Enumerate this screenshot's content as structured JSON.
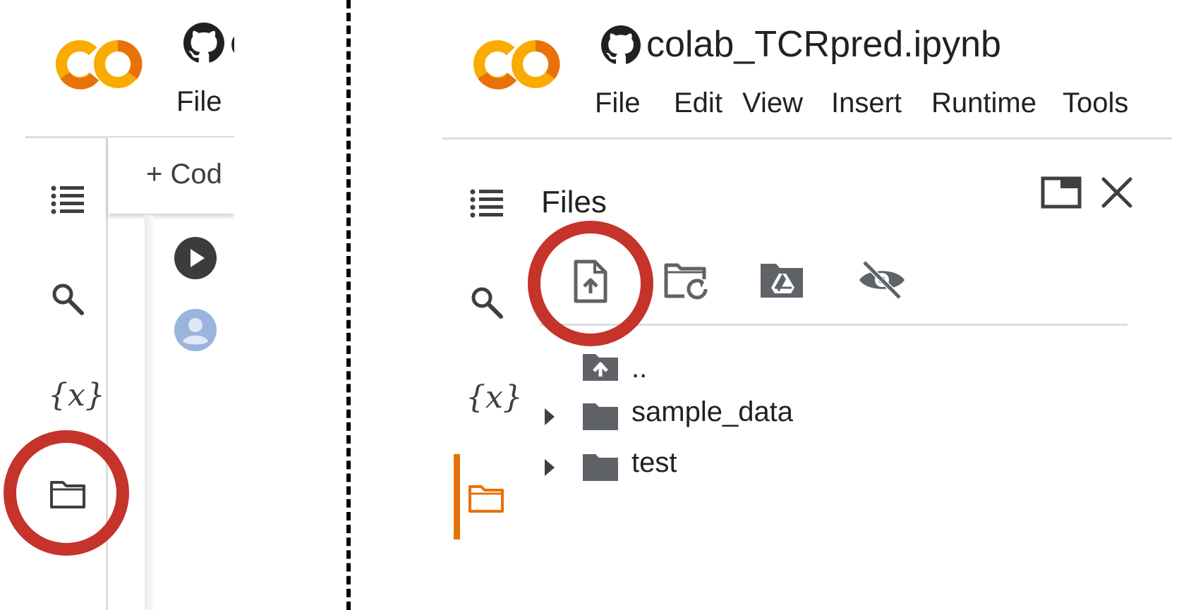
{
  "colors": {
    "logo_orange": "#f9ab00",
    "logo_dark_orange": "#e8710a",
    "highlight_red": "#c5332b",
    "active_orange": "#e8710a",
    "icon_gray": "#5f6368",
    "dark_icon": "#444444",
    "avatar_blue": "#9ab4dc"
  },
  "left_panel": {
    "title_partial": "c",
    "menu": {
      "file_label": "File"
    },
    "toolbar": {
      "add_code_label": "+ Cod"
    },
    "sidebar_icons": [
      "table-of-contents-icon",
      "search-icon",
      "variables-icon",
      "files-folder-icon"
    ],
    "variables_glyph": "{x}"
  },
  "right_panel": {
    "notebook_title": "colab_TCRpred.ipynb",
    "menu": [
      "File",
      "Edit",
      "View",
      "Insert",
      "Runtime",
      "Tools"
    ],
    "files_header": "Files",
    "variables_glyph": "{x}",
    "file_toolbar_icons": [
      "upload-file-icon",
      "refresh-folder-icon",
      "mount-drive-icon",
      "hide-files-icon"
    ],
    "tree": {
      "parent_label": "..",
      "items": [
        {
          "label": "sample_data"
        },
        {
          "label": "test"
        }
      ]
    }
  }
}
